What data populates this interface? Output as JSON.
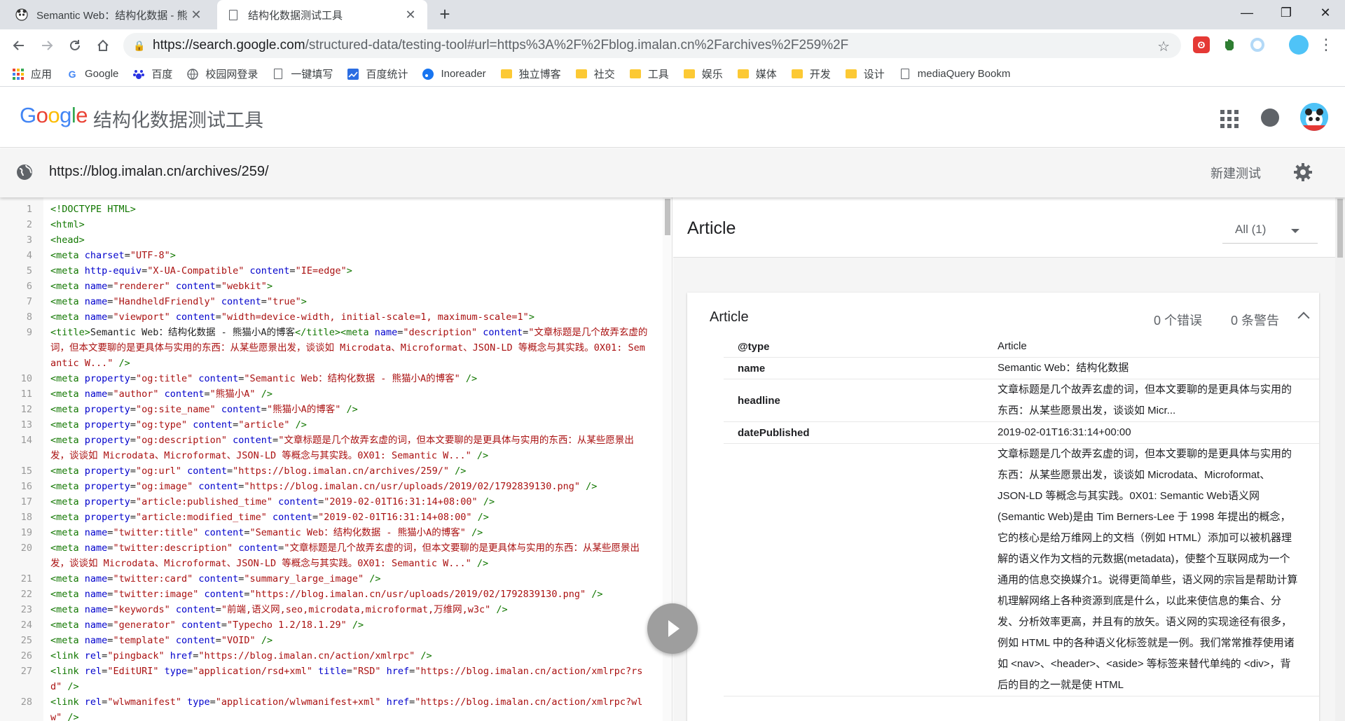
{
  "browser": {
    "tabs": [
      {
        "title": "Semantic Web：结构化数据 - 熊",
        "active": false
      },
      {
        "title": "结构化数据测试工具",
        "active": true
      }
    ],
    "new_tab": "+",
    "window": {
      "minimize": "—",
      "maximize": "❐",
      "close": "✕"
    },
    "address": {
      "host": "https://search.google.com",
      "path": "/structured-data/testing-tool#url=https%3A%2F%2Fblog.imalan.cn%2Farchives%2F259%2F"
    },
    "extension_colors": {
      "red": "#e53935",
      "green": "#2e7d32",
      "blue": "#b3d9f7"
    },
    "bookmarks": [
      {
        "label": "应用",
        "icon": "apps-grid-icon"
      },
      {
        "label": "Google",
        "icon": "google-g-icon"
      },
      {
        "label": "百度",
        "icon": "baidu-paw-icon"
      },
      {
        "label": "校园网登录",
        "icon": "globe-icon"
      },
      {
        "label": "一键填写",
        "icon": "page-icon"
      },
      {
        "label": "百度统计",
        "icon": "chart-icon"
      },
      {
        "label": "Inoreader",
        "icon": "inoreader-icon"
      },
      {
        "label": "独立博客",
        "icon": "folder-icon"
      },
      {
        "label": "社交",
        "icon": "folder-icon"
      },
      {
        "label": "工具",
        "icon": "folder-icon"
      },
      {
        "label": "娱乐",
        "icon": "folder-icon"
      },
      {
        "label": "媒体",
        "icon": "folder-icon"
      },
      {
        "label": "开发",
        "icon": "folder-icon"
      },
      {
        "label": "设计",
        "icon": "folder-icon"
      },
      {
        "label": "mediaQuery Bookm",
        "icon": "page-icon"
      }
    ]
  },
  "app": {
    "logo": "Google",
    "title": "结构化数据测试工具",
    "tested_url": "https://blog.imalan.cn/archives/259/",
    "new_test": "新建测试"
  },
  "code": [
    {
      "n": "1",
      "html": "<span class='tag'>&lt;!DOCTYPE HTML&gt;</span>"
    },
    {
      "n": "2",
      "html": "<span class='tag'>&lt;html&gt;</span>"
    },
    {
      "n": "3",
      "html": "<span class='tag'>&lt;head&gt;</span>"
    },
    {
      "n": "4",
      "html": "<span class='tag'>&lt;meta</span> <span class='at'>charset</span>=<span class='av'>\"UTF-8\"</span><span class='tag'>&gt;</span>"
    },
    {
      "n": "5",
      "html": "<span class='tag'>&lt;meta</span> <span class='at'>http-equiv</span>=<span class='av'>\"X-UA-Compatible\"</span> <span class='at'>content</span>=<span class='av'>\"IE=edge\"</span><span class='tag'>&gt;</span>"
    },
    {
      "n": "6",
      "html": "<span class='tag'>&lt;meta</span> <span class='at'>name</span>=<span class='av'>\"renderer\"</span> <span class='at'>content</span>=<span class='av'>\"webkit\"</span><span class='tag'>&gt;</span>"
    },
    {
      "n": "7",
      "html": "<span class='tag'>&lt;meta</span> <span class='at'>name</span>=<span class='av'>\"HandheldFriendly\"</span> <span class='at'>content</span>=<span class='av'>\"true\"</span><span class='tag'>&gt;</span>"
    },
    {
      "n": "8",
      "html": "<span class='tag'>&lt;meta</span> <span class='at'>name</span>=<span class='av'>\"viewport\"</span> <span class='at'>content</span>=<span class='av'>\"width=device-width, initial-scale=1, maximum-scale=1\"</span><span class='tag'>&gt;</span>"
    },
    {
      "n": "9",
      "html": "<span class='tag'>&lt;title&gt;</span>Semantic Web：结构化数据 - 熊猫小A的博客<span class='tag'>&lt;/title&gt;</span><span class='tag'>&lt;meta</span> <span class='at'>name</span>=<span class='av'>\"description\"</span> <span class='at'>content</span>=<span class='av'>\"文章标题是几个故弄玄虚的词，但本文要聊的是更具体与实用的东西：从某些愿景出发，谈谈如 Microdata、Microformat、JSON-LD 等概念与其实践。0X01: Semantic W...\"</span> <span class='tag'>/&gt;</span>"
    },
    {
      "n": "10",
      "html": "<span class='tag'>&lt;meta</span> <span class='at'>property</span>=<span class='av'>\"og:title\"</span> <span class='at'>content</span>=<span class='av'>\"Semantic Web：结构化数据 - 熊猫小A的博客\"</span> <span class='tag'>/&gt;</span>"
    },
    {
      "n": "11",
      "html": "<span class='tag'>&lt;meta</span> <span class='at'>name</span>=<span class='av'>\"author\"</span> <span class='at'>content</span>=<span class='av'>\"熊猫小A\"</span> <span class='tag'>/&gt;</span>"
    },
    {
      "n": "12",
      "html": "<span class='tag'>&lt;meta</span> <span class='at'>property</span>=<span class='av'>\"og:site_name\"</span> <span class='at'>content</span>=<span class='av'>\"熊猫小A的博客\"</span> <span class='tag'>/&gt;</span>"
    },
    {
      "n": "13",
      "html": "<span class='tag'>&lt;meta</span> <span class='at'>property</span>=<span class='av'>\"og:type\"</span> <span class='at'>content</span>=<span class='av'>\"article\"</span> <span class='tag'>/&gt;</span>"
    },
    {
      "n": "14",
      "html": "<span class='tag'>&lt;meta</span> <span class='at'>property</span>=<span class='av'>\"og:description\"</span> <span class='at'>content</span>=<span class='av'>\"文章标题是几个故弄玄虚的词，但本文要聊的是更具体与实用的东西：从某些愿景出发，谈谈如 Microdata、Microformat、JSON-LD 等概念与其实践。0X01: Semantic W...\"</span> <span class='tag'>/&gt;</span>"
    },
    {
      "n": "15",
      "html": "<span class='tag'>&lt;meta</span> <span class='at'>property</span>=<span class='av'>\"og:url\"</span> <span class='at'>content</span>=<span class='av'>\"https://blog.imalan.cn/archives/259/\"</span> <span class='tag'>/&gt;</span>"
    },
    {
      "n": "16",
      "html": "<span class='tag'>&lt;meta</span> <span class='at'>property</span>=<span class='av'>\"og:image\"</span> <span class='at'>content</span>=<span class='av'>\"https://blog.imalan.cn/usr/uploads/2019/02/1792839130.png\"</span> <span class='tag'>/&gt;</span>"
    },
    {
      "n": "17",
      "html": "<span class='tag'>&lt;meta</span> <span class='at'>property</span>=<span class='av'>\"article:published_time\"</span> <span class='at'>content</span>=<span class='av'>\"2019-02-01T16:31:14+08:00\"</span> <span class='tag'>/&gt;</span>"
    },
    {
      "n": "18",
      "html": "<span class='tag'>&lt;meta</span> <span class='at'>property</span>=<span class='av'>\"article:modified_time\"</span> <span class='at'>content</span>=<span class='av'>\"2019-02-01T16:31:14+08:00\"</span> <span class='tag'>/&gt;</span>"
    },
    {
      "n": "19",
      "html": "<span class='tag'>&lt;meta</span> <span class='at'>name</span>=<span class='av'>\"twitter:title\"</span> <span class='at'>content</span>=<span class='av'>\"Semantic Web：结构化数据 - 熊猫小A的博客\"</span> <span class='tag'>/&gt;</span>"
    },
    {
      "n": "20",
      "html": "<span class='tag'>&lt;meta</span> <span class='at'>name</span>=<span class='av'>\"twitter:description\"</span> <span class='at'>content</span>=<span class='av'>\"文章标题是几个故弄玄虚的词，但本文要聊的是更具体与实用的东西：从某些愿景出发，谈谈如 Microdata、Microformat、JSON-LD 等概念与其实践。0X01: Semantic W...\"</span> <span class='tag'>/&gt;</span>"
    },
    {
      "n": "21",
      "html": "<span class='tag'>&lt;meta</span> <span class='at'>name</span>=<span class='av'>\"twitter:card\"</span> <span class='at'>content</span>=<span class='av'>\"summary_large_image\"</span> <span class='tag'>/&gt;</span>"
    },
    {
      "n": "22",
      "html": "<span class='tag'>&lt;meta</span> <span class='at'>name</span>=<span class='av'>\"twitter:image\"</span> <span class='at'>content</span>=<span class='av'>\"https://blog.imalan.cn/usr/uploads/2019/02/1792839130.png\"</span> <span class='tag'>/&gt;</span>"
    },
    {
      "n": "23",
      "html": "<span class='tag'>&lt;meta</span> <span class='at'>name</span>=<span class='av'>\"keywords\"</span> <span class='at'>content</span>=<span class='av'>\"前端,语义网,seo,microdata,microformat,万维网,w3c\"</span> <span class='tag'>/&gt;</span>"
    },
    {
      "n": "24",
      "html": "<span class='tag'>&lt;meta</span> <span class='at'>name</span>=<span class='av'>\"generator\"</span> <span class='at'>content</span>=<span class='av'>\"Typecho 1.2/18.1.29\"</span> <span class='tag'>/&gt;</span>"
    },
    {
      "n": "25",
      "html": "<span class='tag'>&lt;meta</span> <span class='at'>name</span>=<span class='av'>\"template\"</span> <span class='at'>content</span>=<span class='av'>\"VOID\"</span> <span class='tag'>/&gt;</span>"
    },
    {
      "n": "26",
      "html": "<span class='tag'>&lt;link</span> <span class='at'>rel</span>=<span class='av'>\"pingback\"</span> <span class='at'>href</span>=<span class='av'>\"https://blog.imalan.cn/action/xmlrpc\"</span> <span class='tag'>/&gt;</span>"
    },
    {
      "n": "27",
      "html": "<span class='tag'>&lt;link</span> <span class='at'>rel</span>=<span class='av'>\"EditURI\"</span> <span class='at'>type</span>=<span class='av'>\"application/rsd+xml\"</span> <span class='at'>title</span>=<span class='av'>\"RSD\"</span> <span class='at'>href</span>=<span class='av'>\"https://blog.imalan.cn/action/xmlrpc?rsd\"</span> <span class='tag'>/&gt;</span>"
    },
    {
      "n": "28",
      "html": "<span class='tag'>&lt;link</span> <span class='at'>rel</span>=<span class='av'>\"wlwmanifest\"</span> <span class='at'>type</span>=<span class='av'>\"application/wlwmanifest+xml\"</span> <span class='at'>href</span>=<span class='av'>\"https://blog.imalan.cn/action/xmlrpc?wlw\"</span> <span class='tag'>/&gt;</span>"
    }
  ],
  "results": {
    "header": "Article",
    "filter": "All (1)",
    "card": {
      "title": "Article",
      "errors": "0 个错误",
      "warnings": "0 条警告",
      "props": [
        {
          "key": "@type",
          "value": "Article"
        },
        {
          "key": "name",
          "value": "Semantic Web：结构化数据"
        },
        {
          "key": "headline",
          "value": "文章标题是几个故弄玄虚的词，但本文要聊的是更具体与实用的东西：从某些愿景出发，谈谈如 Micr..."
        },
        {
          "key": "datePublished",
          "value": "2019-02-01T16:31:14+00:00"
        },
        {
          "key": "",
          "value": "文章标题是几个故弄玄虚的词，但本文要聊的是更具体与实用的东西：从某些愿景出发，谈谈如 Microdata、Microformat、JSON-LD 等概念与其实践。0X01: Semantic Web语义网(Semantic Web)是由 Tim Berners-Lee 于 1998 年提出的概念，它的核心是给万维网上的文档（例如 HTML）添加可以被机器理解的语义作为文档的元数据(metadata)，使整个互联网成为一个通用的信息交换媒介1。说得更简单些，语义网的宗旨是帮助计算机理解网络上各种资源到底是什么，以此来使信息的集合、分发、分析效率更高，并且有的放矢。语义网的实现途径有很多，例如 HTML 中的各种语义化标签就是一例。我们常常推荐使用诸如 <nav>、<header>、<aside> 等标签来替代单纯的 <div>，背后的目的之一就是使 HTML"
        }
      ]
    }
  }
}
